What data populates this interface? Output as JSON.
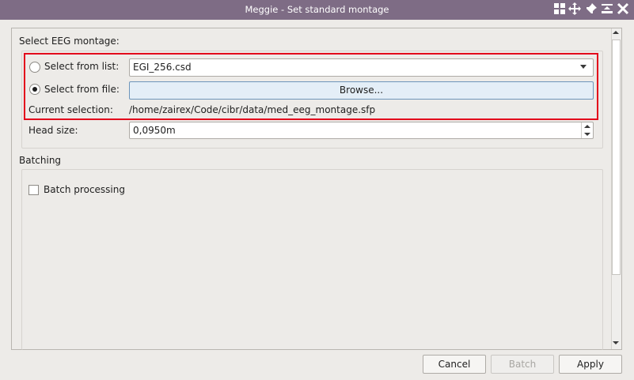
{
  "window": {
    "title": "Meggie - Set standard montage",
    "titlebar_icons": [
      "tile-icon",
      "move-icon",
      "pin-icon",
      "minimize-icon",
      "close-icon"
    ]
  },
  "montage": {
    "section_label": "Select EEG montage:",
    "list_option_label": "Select from list:",
    "list_selected": false,
    "list_value": "EGI_256.csd",
    "file_option_label": "Select from file:",
    "file_selected": true,
    "browse_label": "Browse...",
    "current_selection_label": "Current selection:",
    "current_selection_value": "/home/zairex/Code/cibr/data/med_eeg_montage.sfp",
    "head_size_label": "Head size:",
    "head_size_value": "0,0950m"
  },
  "batching": {
    "section_label": "Batching",
    "batch_processing_label": "Batch processing",
    "batch_processing_checked": false
  },
  "buttons": {
    "cancel": "Cancel",
    "batch": "Batch",
    "apply": "Apply"
  },
  "colors": {
    "titlebar": "#7e6c85",
    "highlight_border": "#e3001b",
    "browse_bg": "#e4eef7"
  }
}
